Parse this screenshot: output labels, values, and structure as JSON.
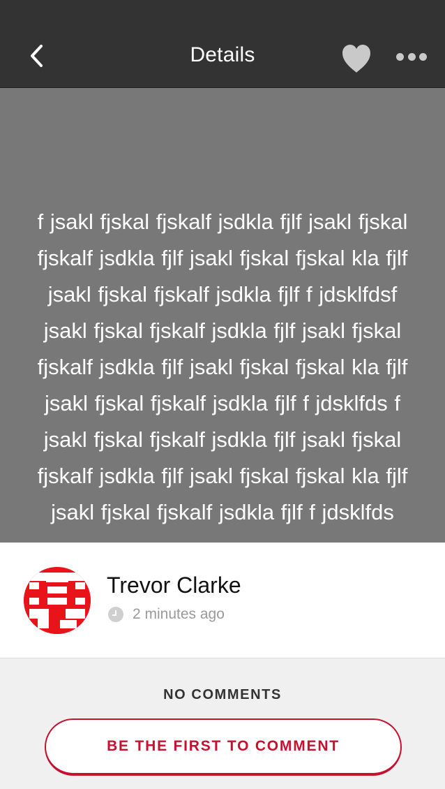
{
  "header": {
    "title": "Details",
    "back_icon": "chevron-left-icon",
    "favorite_icon": "heart-icon",
    "more_icon": "more-horizontal-icon",
    "text_color": "#ffffff",
    "background": "#333333"
  },
  "post": {
    "text": "f jsakl fjskal fjskalf jsdkla fjlf jsakl fjskal fjskalf jsdkla fjlf jsakl fjskal fjskal kla fjlf jsakl fjskal fjskalf jsdkla fjlf f jdsklfdsf jsakl fjskal fjskalf jsdkla fjlf jsakl fjskal fjskalf jsdkla fjlf jsakl fjskal fjskal kla fjlf jsakl fjskal fjskalf jsdkla fjlf f jdsklfds f jsakl fjskal fjskalf jsdkla fjlf jsakl fjskal fjskalf jsdkla fjlf jsakl fjskal fjskal kla fjlf jsakl fjskal fjskalf jsdkla fjlf f jdsklfds",
    "background": "#787878"
  },
  "author": {
    "name": "Trevor Clarke",
    "time": "2 minutes ago",
    "avatar_color": "#e8141a",
    "clock_icon": "clock-icon"
  },
  "comments": {
    "empty_label": "NO COMMENTS",
    "first_comment_label": "BE THE FIRST TO COMMENT",
    "accent": "#c4122f"
  }
}
